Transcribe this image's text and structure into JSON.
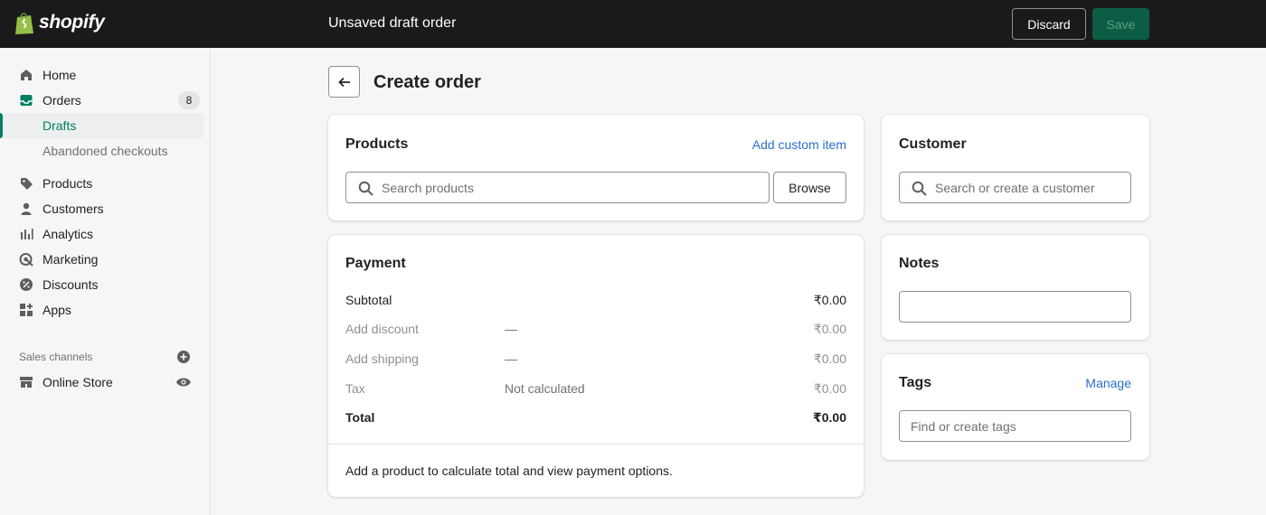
{
  "topbar": {
    "brand": "shopify",
    "title": "Unsaved draft order",
    "discard_label": "Discard",
    "save_label": "Save"
  },
  "sidebar": {
    "home": "Home",
    "orders": "Orders",
    "orders_badge": "8",
    "drafts": "Drafts",
    "abandoned": "Abandoned checkouts",
    "products": "Products",
    "customers": "Customers",
    "analytics": "Analytics",
    "marketing": "Marketing",
    "discounts": "Discounts",
    "apps": "Apps",
    "sales_channels": "Sales channels",
    "online_store": "Online Store"
  },
  "page": {
    "title": "Create order"
  },
  "products_card": {
    "title": "Products",
    "add_custom": "Add custom item",
    "search_placeholder": "Search products",
    "browse": "Browse"
  },
  "payment": {
    "title": "Payment",
    "rows": [
      {
        "label": "Subtotal",
        "mid": "",
        "value": "₹0.00"
      },
      {
        "label": "Add discount",
        "mid": "—",
        "value": "₹0.00"
      },
      {
        "label": "Add shipping",
        "mid": "—",
        "value": "₹0.00"
      },
      {
        "label": "Tax",
        "mid": "Not calculated",
        "value": "₹0.00"
      },
      {
        "label": "Total",
        "mid": "",
        "value": "₹0.00"
      }
    ],
    "note": "Add a product to calculate total and view payment options."
  },
  "customer": {
    "title": "Customer",
    "search_placeholder": "Search or create a customer"
  },
  "notes": {
    "title": "Notes"
  },
  "tags": {
    "title": "Tags",
    "manage": "Manage",
    "placeholder": "Find or create tags"
  },
  "colors": {
    "topbar": "#1a1a1a",
    "accent": "#008060",
    "link": "#2c6ecb",
    "save_bg": "#0b5e45"
  }
}
